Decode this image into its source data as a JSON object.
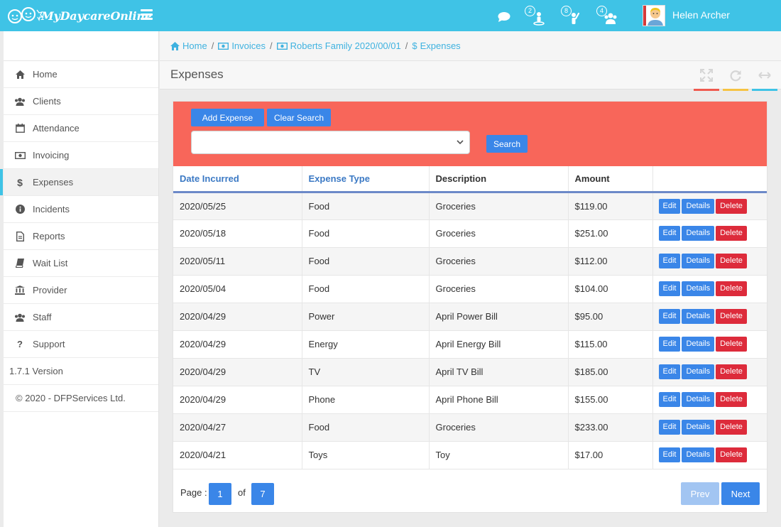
{
  "app": {
    "logo_text": "MyDaycareOnline",
    "brand_color": "#3fc3e6"
  },
  "topbar": {
    "chat_icon": "speech-bubble-icon",
    "badges": [
      {
        "count": "2",
        "icon": "child-icon"
      },
      {
        "count": "8",
        "icon": "person-raise-hand-icon"
      },
      {
        "count": "4",
        "icon": "users-icon"
      }
    ],
    "user_name": "Helen Archer"
  },
  "sidebar": {
    "items": [
      {
        "label": "Home",
        "icon": "home-icon"
      },
      {
        "label": "Clients",
        "icon": "users-icon"
      },
      {
        "label": "Attendance",
        "icon": "calendar-icon"
      },
      {
        "label": "Invoicing",
        "icon": "money-icon"
      },
      {
        "label": "Expenses",
        "icon": "dollar-icon"
      },
      {
        "label": "Incidents",
        "icon": "info-icon"
      },
      {
        "label": "Reports",
        "icon": "document-icon"
      },
      {
        "label": "Wait List",
        "icon": "book-icon"
      },
      {
        "label": "Provider",
        "icon": "bank-icon"
      },
      {
        "label": "Staff",
        "icon": "users-icon"
      },
      {
        "label": "Support",
        "icon": "question-icon"
      }
    ],
    "version": "1.7.1 Version",
    "copyright": "©  2020 - DFPServices Ltd."
  },
  "breadcrumb": [
    {
      "label": "Home",
      "icon": "home-icon"
    },
    {
      "label": "Invoices",
      "icon": "money-icon"
    },
    {
      "label": "Roberts Family 2020/00/01",
      "icon": "money-icon"
    },
    {
      "label": "Expenses",
      "icon": "dollar-icon"
    }
  ],
  "page": {
    "title": "Expenses",
    "tools": [
      "expand-icon",
      "refresh-icon",
      "collapse-horizontal-icon"
    ]
  },
  "filter": {
    "add_label": "Add Expense",
    "clear_label": "Clear Search",
    "search_label": "Search",
    "select_value": ""
  },
  "table": {
    "columns": [
      "Date Incurred",
      "Expense Type",
      "Description",
      "Amount"
    ],
    "rows": [
      {
        "date": "2020/05/25",
        "type": "Food",
        "desc": "Groceries",
        "amount": "$119.00"
      },
      {
        "date": "2020/05/18",
        "type": "Food",
        "desc": "Groceries",
        "amount": "$251.00"
      },
      {
        "date": "2020/05/11",
        "type": "Food",
        "desc": "Groceries",
        "amount": "$112.00"
      },
      {
        "date": "2020/05/04",
        "type": "Food",
        "desc": "Groceries",
        "amount": "$104.00"
      },
      {
        "date": "2020/04/29",
        "type": "Power",
        "desc": "April Power Bill",
        "amount": "$95.00"
      },
      {
        "date": "2020/04/29",
        "type": "Energy",
        "desc": "April Energy Bill",
        "amount": "$115.00"
      },
      {
        "date": "2020/04/29",
        "type": "TV",
        "desc": "April TV Bill",
        "amount": "$185.00"
      },
      {
        "date": "2020/04/29",
        "type": "Phone",
        "desc": "April Phone Bill",
        "amount": "$155.00"
      },
      {
        "date": "2020/04/27",
        "type": "Food",
        "desc": "Groceries",
        "amount": "$233.00"
      },
      {
        "date": "2020/04/21",
        "type": "Toys",
        "desc": "Toy",
        "amount": "$17.00"
      }
    ],
    "actions": {
      "edit": "Edit",
      "details": "Details",
      "delete": "Delete"
    }
  },
  "pagination": {
    "page_label": "Page :",
    "current": "1",
    "of_label": "of",
    "total": "7",
    "prev_label": "Prev",
    "next_label": "Next"
  }
}
